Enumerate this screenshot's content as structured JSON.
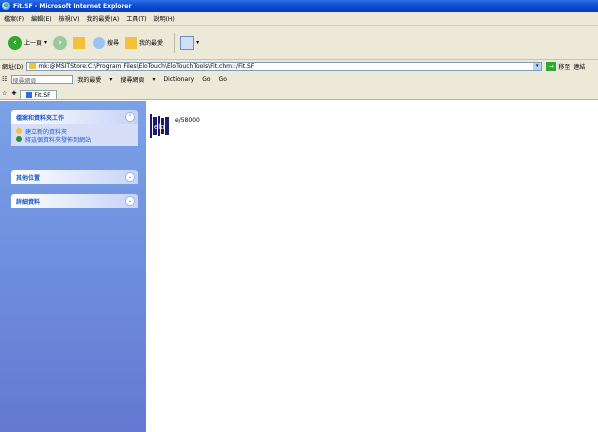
{
  "window": {
    "title": "Fit.SF - Microsoft Internet Explorer"
  },
  "menu": {
    "items": [
      "檔案(F)",
      "編輯(E)",
      "檢視(V)",
      "我的最愛(A)",
      "工具(T)",
      "說明(H)"
    ]
  },
  "toolbar": {
    "back_label": "上一頁",
    "search_label": "搜尋",
    "favorites_label": "我的最愛"
  },
  "address": {
    "label": "網址(D)",
    "value": "mk:@MSITStore:C:\\Program Files\\EloTouch\\EloTouchTools\\Fit.chm::/Fit.SF",
    "go_label": "移至",
    "links_label": "連結"
  },
  "links_bar": {
    "search_placeholder": "搜尋網頁",
    "items": [
      "我的最愛",
      "▾",
      "搜尋網頁",
      "▾",
      "Dictionary",
      "Go",
      "Go"
    ]
  },
  "tab": {
    "label": "Fit.SF"
  },
  "sidebar": {
    "panel1": {
      "title": "檔案和資料夾工作",
      "items": [
        "建立新的資料夾",
        "將這個資料夾發佈到網站"
      ]
    },
    "panel2": {
      "title": "其他位置"
    },
    "panel3": {
      "title": "詳細資料"
    }
  },
  "content": {
    "logo_text": "elo",
    "model": "e/58000"
  },
  "colors": {
    "titlebar": "#0a48d0",
    "sidebar_top": "#7ba2e7",
    "sidebar_bottom": "#6379d3",
    "panel_title": "#215dc6"
  }
}
